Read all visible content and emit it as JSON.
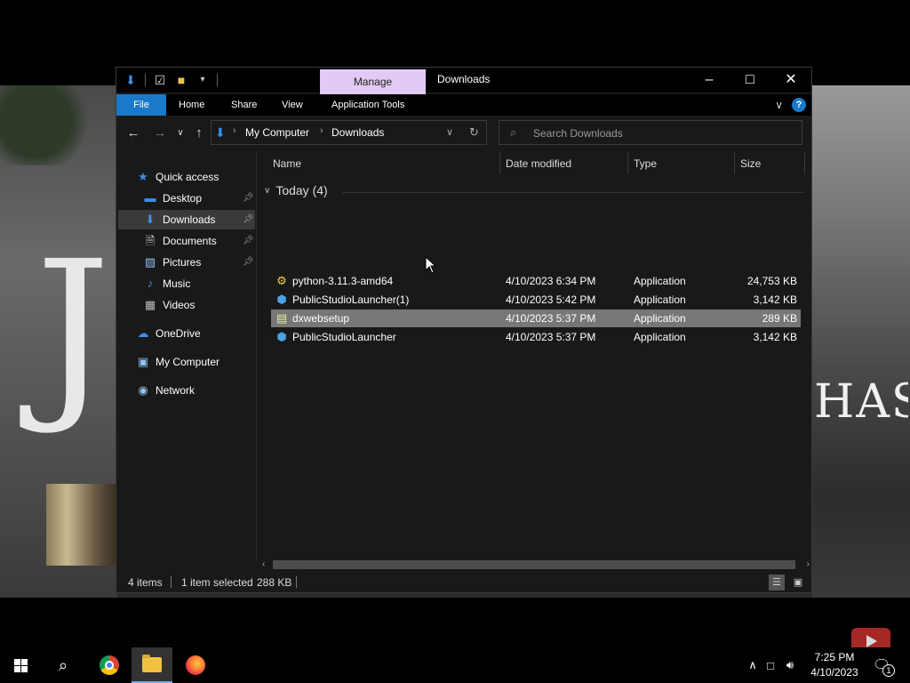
{
  "window": {
    "title": "Downloads",
    "contextual_tab": "Manage"
  },
  "ribbon": {
    "tabs": [
      "File",
      "Home",
      "Share",
      "View",
      "Application Tools"
    ]
  },
  "address_bar": {
    "crumbs": [
      "My Computer",
      "Downloads"
    ]
  },
  "search": {
    "placeholder": "Search Downloads"
  },
  "nav_pane": {
    "items": [
      {
        "label": "Quick access",
        "icon": "star-icon"
      },
      {
        "label": "Desktop",
        "icon": "desktop-icon",
        "pinned": true
      },
      {
        "label": "Downloads",
        "icon": "download-arrow-icon",
        "pinned": true,
        "selected": true
      },
      {
        "label": "Documents",
        "icon": "document-icon",
        "pinned": true
      },
      {
        "label": "Pictures",
        "icon": "pictures-icon",
        "pinned": true
      },
      {
        "label": "Music",
        "icon": "music-note-icon"
      },
      {
        "label": "Videos",
        "icon": "video-icon"
      },
      {
        "label": "OneDrive",
        "icon": "cloud-icon"
      },
      {
        "label": "My Computer",
        "icon": "computer-icon"
      },
      {
        "label": "Network",
        "icon": "network-icon"
      }
    ]
  },
  "file_list": {
    "columns": [
      "Name",
      "Date modified",
      "Type",
      "Size"
    ],
    "group": "Today (4)",
    "rows": [
      {
        "name": "python-3.11.3-amd64",
        "date": "4/10/2023 6:34 PM",
        "type": "Application",
        "size": "24,753 KB",
        "icon": "python-installer-icon"
      },
      {
        "name": "PublicStudioLauncher(1)",
        "date": "4/10/2023 5:42 PM",
        "type": "Application",
        "size": "3,142 KB",
        "icon": "hexagon-app-icon"
      },
      {
        "name": "dxwebsetup",
        "date": "4/10/2023 5:37 PM",
        "type": "Application",
        "size": "289 KB",
        "icon": "setup-icon",
        "selected": true
      },
      {
        "name": "PublicStudioLauncher",
        "date": "4/10/2023 5:37 PM",
        "type": "Application",
        "size": "3,142 KB",
        "icon": "hexagon-app-icon"
      }
    ]
  },
  "status_bar": {
    "item_count": "4 items",
    "selection": "1 item selected",
    "selection_size": "288 KB"
  },
  "taskbar": {
    "time": "7:25 PM",
    "date": "4/10/2023",
    "notification_count": "1"
  },
  "colors": {
    "accent": "#1979ca",
    "manage_tab": "#e3c9f4",
    "selected_row": "#777777"
  }
}
